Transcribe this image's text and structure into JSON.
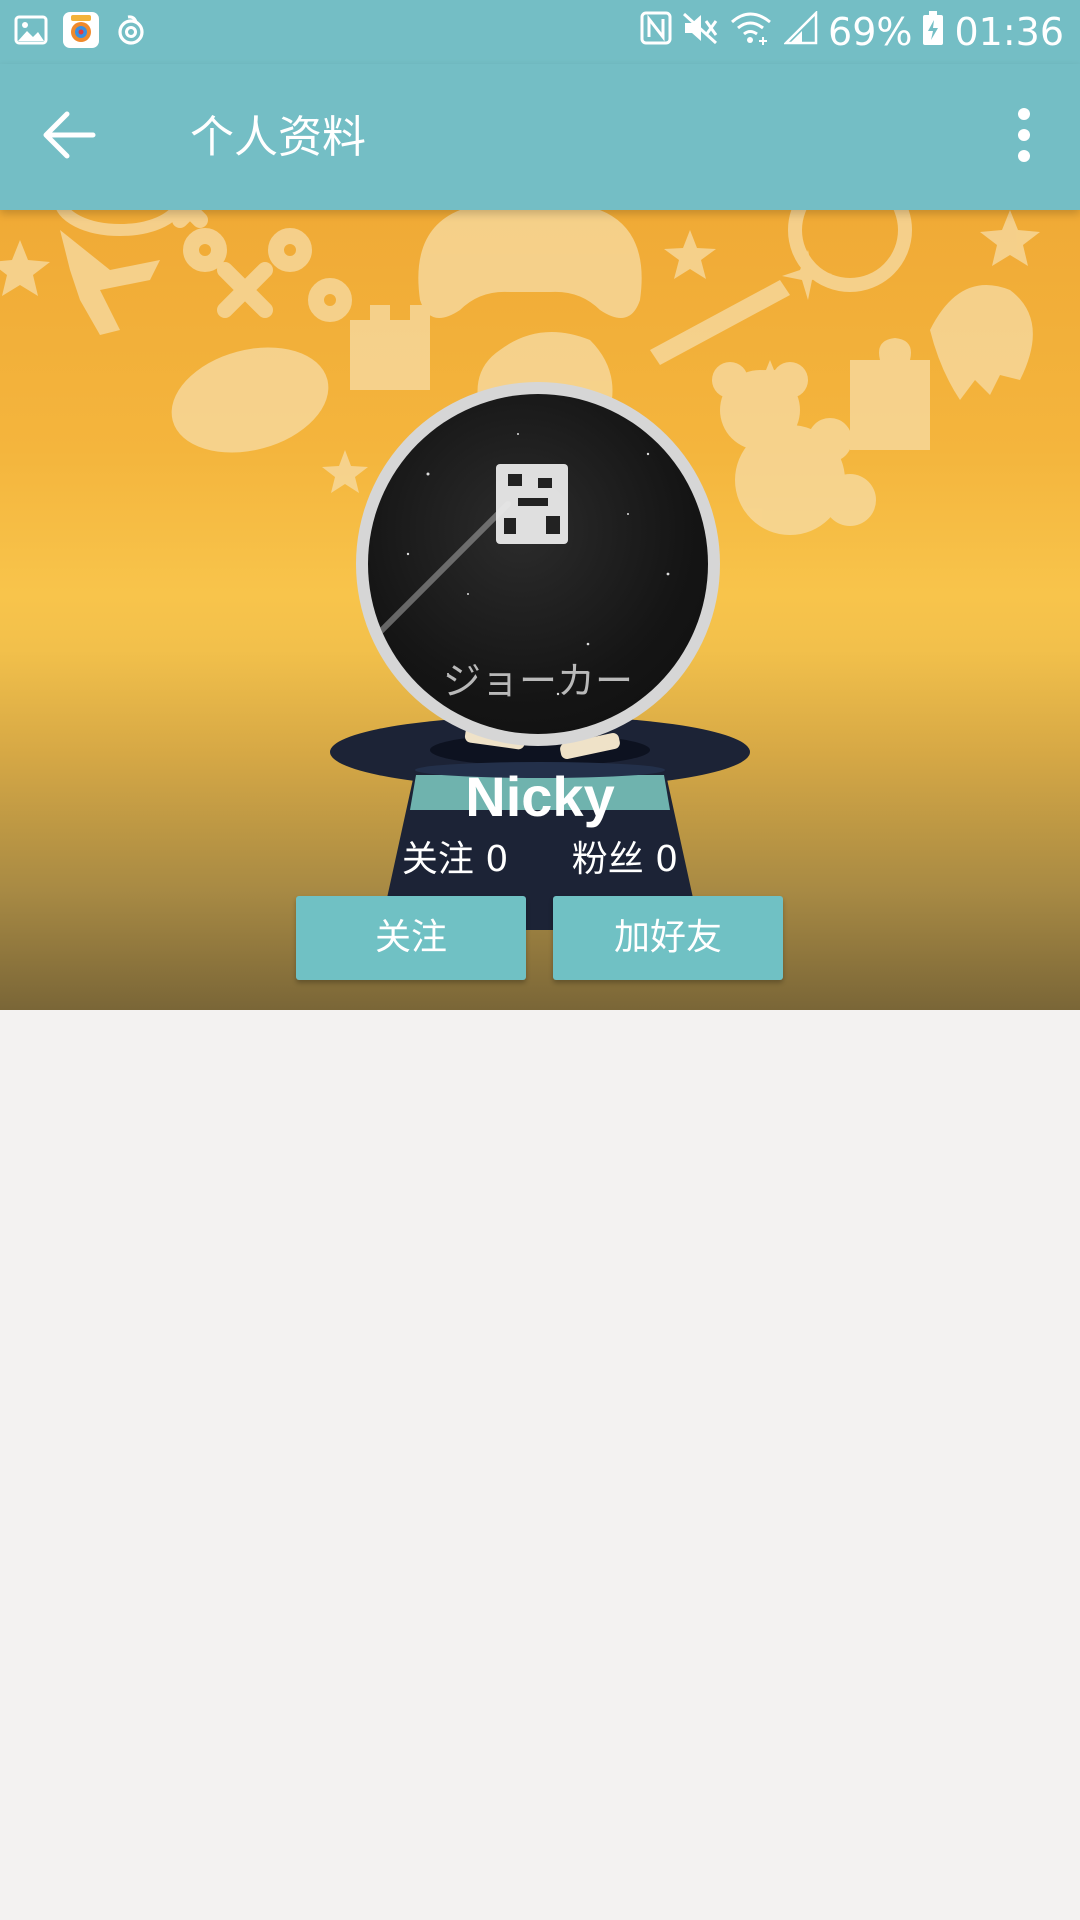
{
  "status_bar": {
    "battery": "69%",
    "time": "01:36",
    "icons": [
      "gallery-icon",
      "app-badge-icon",
      "netease-music-icon",
      "nfc-icon",
      "mute-icon",
      "wifi-icon",
      "signal-icon",
      "battery-charging-icon"
    ]
  },
  "app_bar": {
    "title": "个人资料",
    "back_icon": "arrow-left-icon",
    "menu_icon": "more-vert-icon"
  },
  "profile": {
    "name": "Nicky",
    "avatar_text": "ジョーカー",
    "following_label": "关注 0",
    "followers_label": "粉丝 0"
  },
  "actions": {
    "follow_label": "关注",
    "add_friend_label": "加好友"
  },
  "colors": {
    "bar": "#74bec5",
    "button": "#70c1c4",
    "banner_top": "#f0aa36",
    "background": "#f3f2f1"
  }
}
